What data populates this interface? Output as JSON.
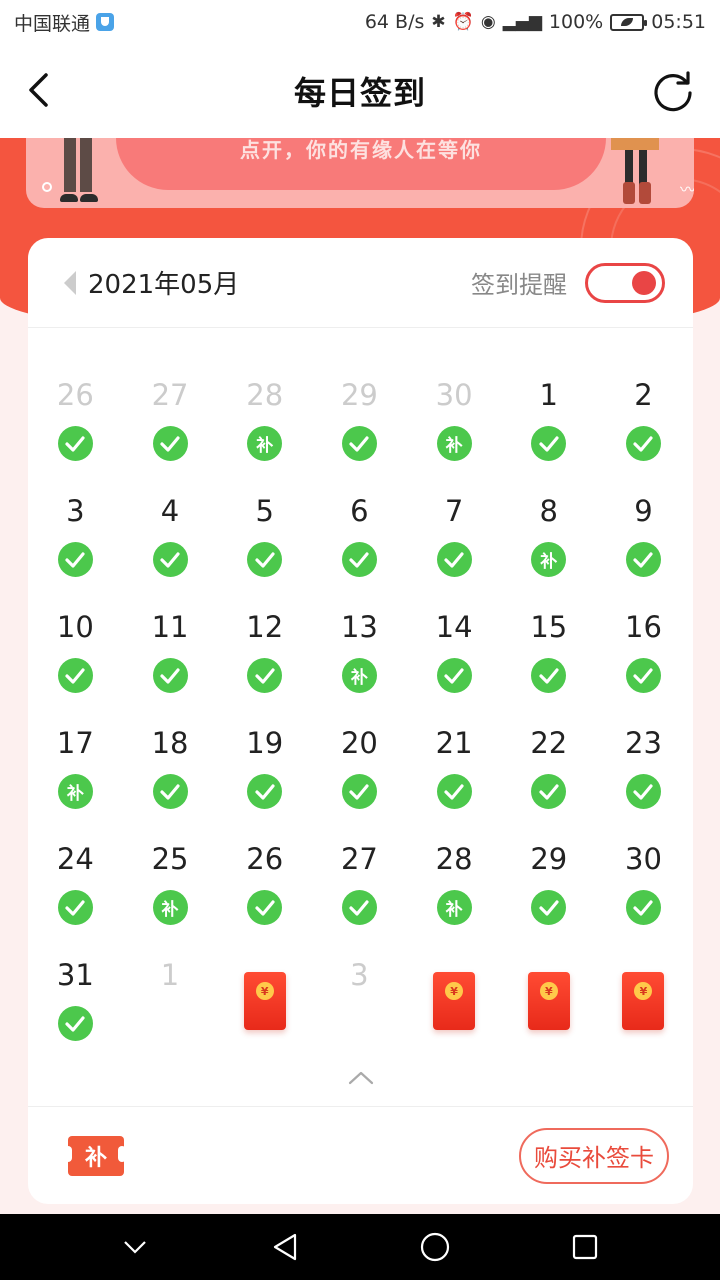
{
  "status_bar": {
    "carrier": "中国联通",
    "speed": "64 B/s",
    "battery": "100%",
    "time": "05:51"
  },
  "header": {
    "title": "每日签到"
  },
  "banner": {
    "text": "点开，你的有缘人在等你"
  },
  "calendar": {
    "month_label": "2021年05月",
    "reminder_label": "签到提醒",
    "reminder_on": true,
    "makeup_label": "补",
    "coin_label": "¥",
    "days": [
      {
        "num": "26",
        "other": true,
        "status": "checked"
      },
      {
        "num": "27",
        "other": true,
        "status": "checked"
      },
      {
        "num": "28",
        "other": true,
        "status": "makeup"
      },
      {
        "num": "29",
        "other": true,
        "status": "checked"
      },
      {
        "num": "30",
        "other": true,
        "status": "makeup"
      },
      {
        "num": "1",
        "other": false,
        "status": "checked"
      },
      {
        "num": "2",
        "other": false,
        "status": "checked"
      },
      {
        "num": "3",
        "other": false,
        "status": "checked"
      },
      {
        "num": "4",
        "other": false,
        "status": "checked"
      },
      {
        "num": "5",
        "other": false,
        "status": "checked"
      },
      {
        "num": "6",
        "other": false,
        "status": "checked"
      },
      {
        "num": "7",
        "other": false,
        "status": "checked"
      },
      {
        "num": "8",
        "other": false,
        "status": "makeup"
      },
      {
        "num": "9",
        "other": false,
        "status": "checked"
      },
      {
        "num": "10",
        "other": false,
        "status": "checked"
      },
      {
        "num": "11",
        "other": false,
        "status": "checked"
      },
      {
        "num": "12",
        "other": false,
        "status": "checked"
      },
      {
        "num": "13",
        "other": false,
        "status": "makeup"
      },
      {
        "num": "14",
        "other": false,
        "status": "checked"
      },
      {
        "num": "15",
        "other": false,
        "status": "checked"
      },
      {
        "num": "16",
        "other": false,
        "status": "checked"
      },
      {
        "num": "17",
        "other": false,
        "status": "makeup"
      },
      {
        "num": "18",
        "other": false,
        "status": "checked"
      },
      {
        "num": "19",
        "other": false,
        "status": "checked"
      },
      {
        "num": "20",
        "other": false,
        "status": "checked"
      },
      {
        "num": "21",
        "other": false,
        "status": "checked"
      },
      {
        "num": "22",
        "other": false,
        "status": "checked"
      },
      {
        "num": "23",
        "other": false,
        "status": "checked"
      },
      {
        "num": "24",
        "other": false,
        "status": "checked"
      },
      {
        "num": "25",
        "other": false,
        "status": "makeup"
      },
      {
        "num": "26",
        "other": false,
        "status": "checked"
      },
      {
        "num": "27",
        "other": false,
        "status": "checked"
      },
      {
        "num": "28",
        "other": false,
        "status": "makeup"
      },
      {
        "num": "29",
        "other": false,
        "status": "checked"
      },
      {
        "num": "30",
        "other": false,
        "status": "checked"
      },
      {
        "num": "31",
        "other": false,
        "status": "checked"
      },
      {
        "num": "1",
        "other": true,
        "status": "none"
      },
      {
        "num": "",
        "other": true,
        "status": "redpacket"
      },
      {
        "num": "3",
        "other": true,
        "status": "none"
      },
      {
        "num": "",
        "other": true,
        "status": "redpacket"
      },
      {
        "num": "",
        "other": true,
        "status": "redpacket"
      },
      {
        "num": "",
        "other": true,
        "status": "redpacket"
      }
    ]
  },
  "footer": {
    "ticket_label": "补",
    "buy_button": "购买补签卡"
  },
  "colors": {
    "accent_red": "#f4553f",
    "check_green": "#4cc84c"
  },
  "icons": {
    "back": "back-icon",
    "refresh": "refresh-icon",
    "check": "check-icon",
    "collapse": "chevron-up-icon"
  }
}
